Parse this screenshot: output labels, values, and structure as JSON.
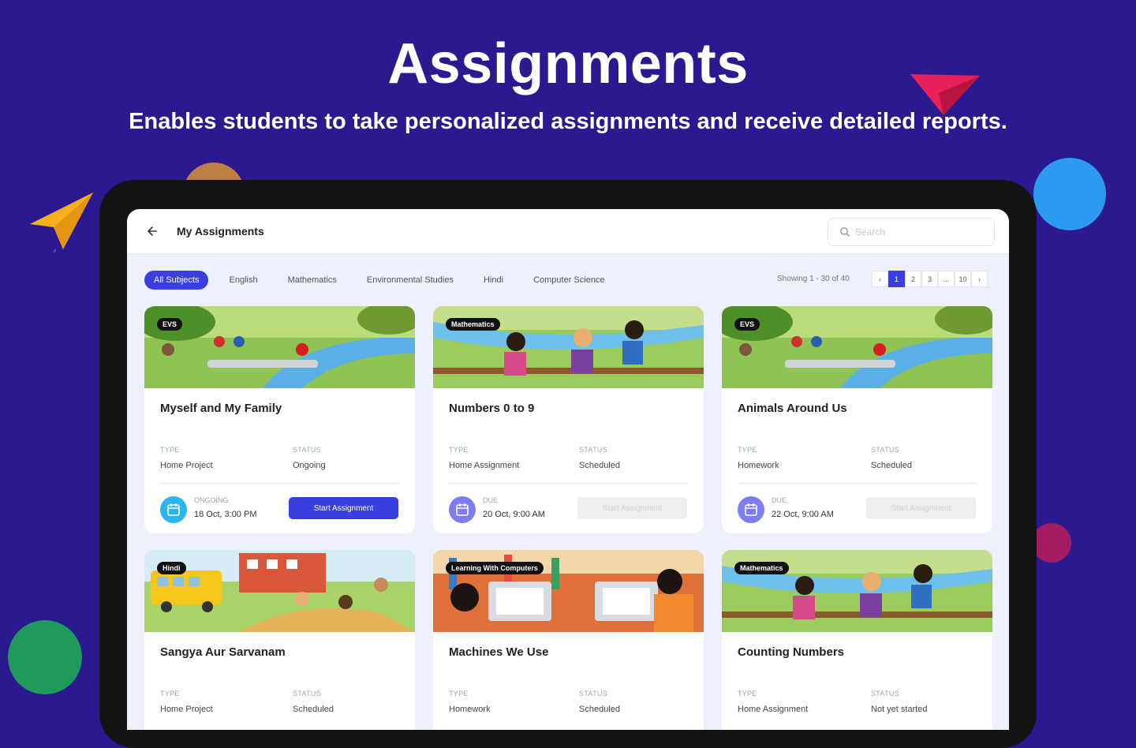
{
  "hero": {
    "title": "Assignments",
    "subtitle": "Enables students to take personalized assignments and receive detailed reports."
  },
  "app": {
    "title": "My Assignments",
    "search_placeholder": "Search"
  },
  "filters": [
    "All Subjects",
    "English",
    "Mathematics",
    "Environmental Studies",
    "Hindi",
    "Computer Science"
  ],
  "active_filter": "All Subjects",
  "pagination": {
    "showing": "Showing 1 - 30 of 40",
    "pages": [
      "‹",
      "1",
      "2",
      "3",
      "...",
      "10",
      "›"
    ],
    "current": "1"
  },
  "labels": {
    "type": "TYPE",
    "status": "STATUS"
  },
  "colors": {
    "background": "#2b1a8f",
    "accent": "#3b3fe0",
    "cyan": "#2bb5f0",
    "purple": "#7d7cf0"
  },
  "cards": [
    {
      "tag": "EVS",
      "title": "Myself and My Family",
      "type": "Home Project",
      "status": "Ongoing",
      "date_label": "ONGOING",
      "date": "18 Oct, 3:00 PM",
      "button": "Start Assignment",
      "button_enabled": true
    },
    {
      "tag": "Mathematics",
      "title": "Numbers 0 to 9",
      "type": "Home Assignment",
      "status": "Scheduled",
      "date_label": "DUE",
      "date": "20 Oct, 9:00 AM",
      "button": "Start Assignment",
      "button_enabled": false
    },
    {
      "tag": "EVS",
      "title": "Animals Around Us",
      "type": "Homework",
      "status": "Scheduled",
      "date_label": "DUE",
      "date": "22 Oct, 9:00 AM",
      "button": "Start Assignment",
      "button_enabled": false
    },
    {
      "tag": "Hindi",
      "title": "Sangya Aur Sarvanam",
      "type": "Home Project",
      "status": "Scheduled"
    },
    {
      "tag": "Learning With Computers",
      "title": "Machines We Use",
      "type": "Homework",
      "status": "Scheduled"
    },
    {
      "tag": "Mathematics",
      "title": "Counting Numbers",
      "type": "Home Assignment",
      "status": "Not yet started"
    }
  ]
}
